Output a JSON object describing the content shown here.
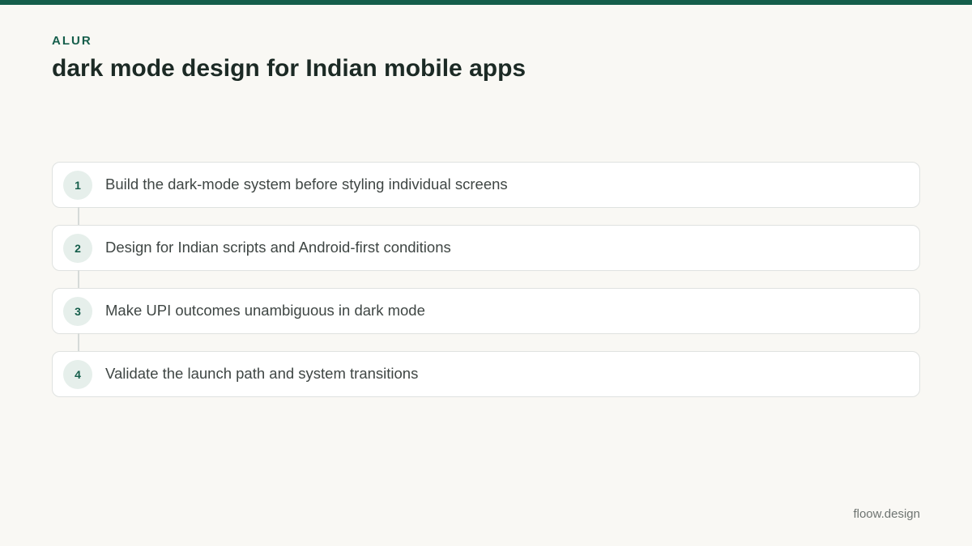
{
  "header": {
    "eyebrow": "ALUR",
    "title": "dark mode design for Indian mobile apps"
  },
  "steps": [
    {
      "number": "1",
      "label": "Build the dark-mode system before styling individual screens"
    },
    {
      "number": "2",
      "label": "Design for Indian scripts and Android-first conditions"
    },
    {
      "number": "3",
      "label": "Make UPI outcomes unambiguous in dark mode"
    },
    {
      "number": "4",
      "label": "Validate the launch path and system transitions"
    }
  ],
  "footer": {
    "brand": "floow.design"
  },
  "colors": {
    "accent": "#155e4b",
    "background": "#f9f8f4",
    "card": "#ffffff",
    "badge_bg": "#e6efeb"
  }
}
